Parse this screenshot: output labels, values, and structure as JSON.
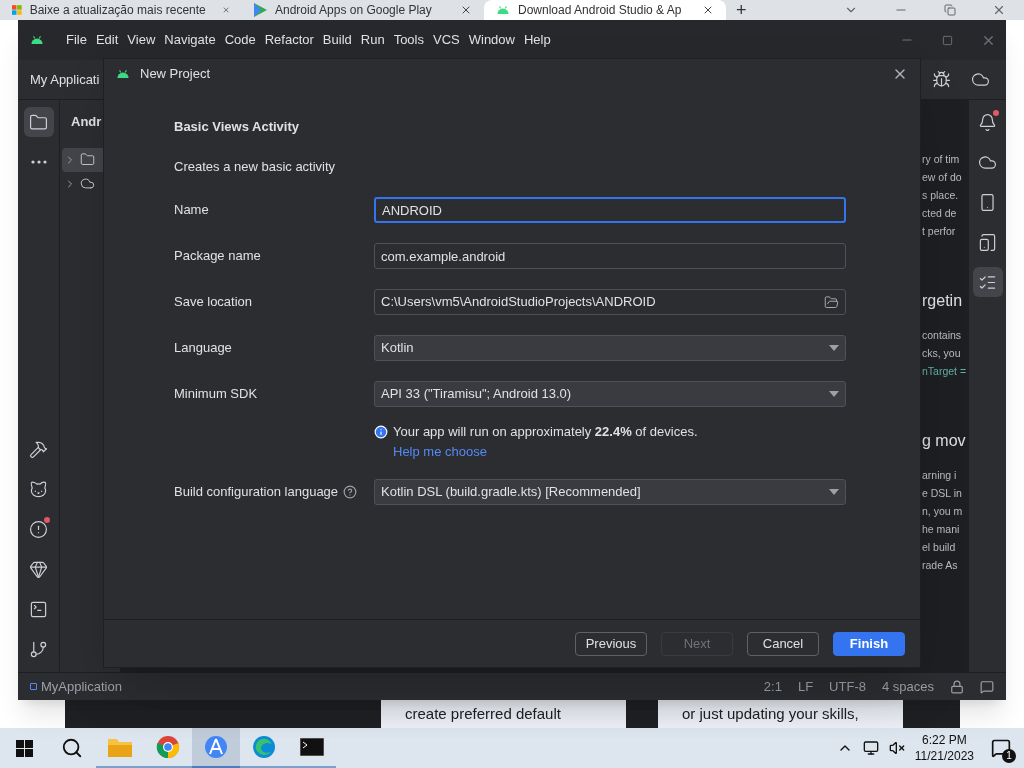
{
  "browser": {
    "tabs": [
      {
        "title": "Baixe a atualização mais recente",
        "selected": false,
        "kind": "windows"
      },
      {
        "title": "Android Apps on Google Play",
        "selected": false,
        "kind": "play"
      },
      {
        "title": "Download Android Studio & Ap",
        "selected": true,
        "kind": "android"
      }
    ],
    "new_tab": "+",
    "page_cards": [
      "create preferred default",
      "or just updating your skills,"
    ]
  },
  "ide": {
    "menu": [
      "File",
      "Edit",
      "View",
      "Navigate",
      "Code",
      "Refactor",
      "Build",
      "Run",
      "Tools",
      "VCS",
      "Window",
      "Help"
    ],
    "toolbar_title": "My Applicati",
    "project_title": "Andr",
    "tree": [
      {
        "kind": "module",
        "expanded": false,
        "selected": true
      },
      {
        "kind": "gradle",
        "expanded": false,
        "selected": false
      }
    ],
    "left_stripe_top": [
      {
        "kind": "folder",
        "selected": true,
        "badge": false
      },
      {
        "kind": "more",
        "selected": false,
        "badge": false
      }
    ],
    "left_stripe_bottom": [
      {
        "kind": "build",
        "selected": false,
        "badge": false
      },
      {
        "kind": "logcat",
        "selected": false,
        "badge": false
      },
      {
        "kind": "problems",
        "selected": false,
        "badge": true
      },
      {
        "kind": "gem",
        "selected": false,
        "badge": false
      },
      {
        "kind": "terminal",
        "selected": false,
        "badge": false
      },
      {
        "kind": "git",
        "selected": false,
        "badge": false
      }
    ],
    "right_stripe": [
      {
        "kind": "bell",
        "selected": false,
        "badge": true
      },
      {
        "kind": "gradle",
        "selected": false,
        "badge": false
      },
      {
        "kind": "device",
        "selected": false,
        "badge": false
      },
      {
        "kind": "devices",
        "selected": false,
        "badge": false
      },
      {
        "kind": "list",
        "selected": true,
        "badge": false
      }
    ],
    "doc_fragments": [
      {
        "kind": "text",
        "lines": [
          "ry of tim",
          "ew of do",
          "s place.",
          "cted de",
          "t perfor"
        ]
      },
      {
        "kind": "heading",
        "lines": [
          "rgetin"
        ]
      },
      {
        "kind": "text",
        "lines": [
          "contains",
          "cks, you"
        ]
      },
      {
        "kind": "code",
        "lines": [
          "nTarget ="
        ]
      },
      {
        "kind": "heading",
        "lines": [
          "g mov"
        ]
      },
      {
        "kind": "text",
        "lines": [
          "arning i",
          "e DSL in",
          "n, you m",
          "he mani",
          "el build",
          "rade As"
        ]
      }
    ],
    "status_bar": {
      "project": "MyApplication",
      "items": [
        "2:1",
        "LF",
        "UTF-8",
        "4 spaces"
      ]
    }
  },
  "dialog": {
    "title": "New Project",
    "heading": "Basic Views Activity",
    "description": "Creates a new basic activity",
    "fields": [
      {
        "kind": "text",
        "label": "Name",
        "value": "ANDROID",
        "focused": true
      },
      {
        "kind": "text",
        "label": "Package name",
        "value": "com.example.android",
        "focused": false
      },
      {
        "kind": "folder",
        "label": "Save location",
        "value": "C:\\Users\\vm5\\AndroidStudioProjects\\ANDROID",
        "focused": false
      },
      {
        "kind": "dropdown",
        "label": "Language",
        "value": "Kotlin",
        "focused": false
      },
      {
        "kind": "dropdown",
        "label": "Minimum SDK",
        "value": "API 33 (\"Tiramisu\"; Android 13.0)",
        "focused": false
      }
    ],
    "info": "Your app will run on approximately **22.4%** of devices.",
    "help_link": "Help me choose",
    "build_field": {
      "label": "Build configuration language",
      "value": "Kotlin DSL (build.gradle.kts) [Recommended]"
    },
    "buttons": [
      {
        "label": "Previous",
        "kind": "secondary",
        "disabled": false
      },
      {
        "label": "Next",
        "kind": "secondary",
        "disabled": true
      },
      {
        "label": "Cancel",
        "kind": "secondary",
        "disabled": false
      },
      {
        "label": "Finish",
        "kind": "primary",
        "disabled": false
      }
    ]
  },
  "taskbar": {
    "apps": [
      {
        "kind": "search",
        "selected": false
      },
      {
        "kind": "explorer",
        "selected": false
      },
      {
        "kind": "chrome",
        "selected": false
      },
      {
        "kind": "studio",
        "selected": true
      },
      {
        "kind": "edge",
        "selected": false
      },
      {
        "kind": "terminal",
        "selected": false
      }
    ],
    "time": "6:22 PM",
    "date": "11/21/2023",
    "notifications": "1"
  }
}
